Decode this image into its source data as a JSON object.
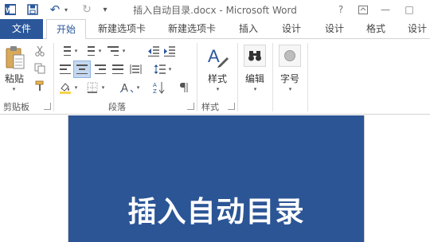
{
  "window": {
    "title": "插入自动目录.docx - Microsoft Word",
    "help_glyph": "?",
    "minimize_glyph": "—",
    "restore_glyph": "□"
  },
  "qat": {
    "undo_glyph": "↶",
    "redo_glyph": "↻",
    "customize_glyph": "▾"
  },
  "tabs": [
    {
      "label": "文件"
    },
    {
      "label": "开始"
    },
    {
      "label": "新建选项卡"
    },
    {
      "label": "新建选项卡"
    },
    {
      "label": "插入"
    },
    {
      "label": "设计"
    },
    {
      "label": "设计"
    },
    {
      "label": "格式"
    },
    {
      "label": "设计"
    }
  ],
  "ribbon": {
    "clipboard": {
      "paste_label": "粘贴",
      "group_label": "剪贴板"
    },
    "paragraph": {
      "group_label": "段落",
      "sort_glyph": "A↓Z",
      "style_glyph": "A"
    },
    "styles": {
      "big_label": "样式",
      "group_label": "样式",
      "big_glyph": "A"
    },
    "editing": {
      "big_label": "编辑"
    },
    "font_size": {
      "big_label": "字号"
    }
  },
  "document": {
    "heading": "插入自动目录"
  },
  "colors": {
    "accent": "#2b579a",
    "page_banner": "#2c5596"
  },
  "icons": [
    "word-logo-icon",
    "save-icon",
    "undo-icon",
    "redo-icon",
    "customize-qat-icon",
    "help-icon",
    "ribbon-display-icon",
    "minimize-icon",
    "restore-icon",
    "paste-icon",
    "cut-icon",
    "copy-icon",
    "format-painter-icon",
    "bullets-icon",
    "numbering-icon",
    "multilevel-list-icon",
    "decrease-indent-icon",
    "increase-indent-icon",
    "align-left-icon",
    "center-icon",
    "align-right-icon",
    "justify-icon",
    "distributed-icon",
    "line-spacing-icon",
    "shading-icon",
    "borders-icon",
    "chinese-layout-icon",
    "sort-icon",
    "show-marks-icon",
    "styles-icon",
    "binoculars-icon",
    "font-size-icon"
  ]
}
